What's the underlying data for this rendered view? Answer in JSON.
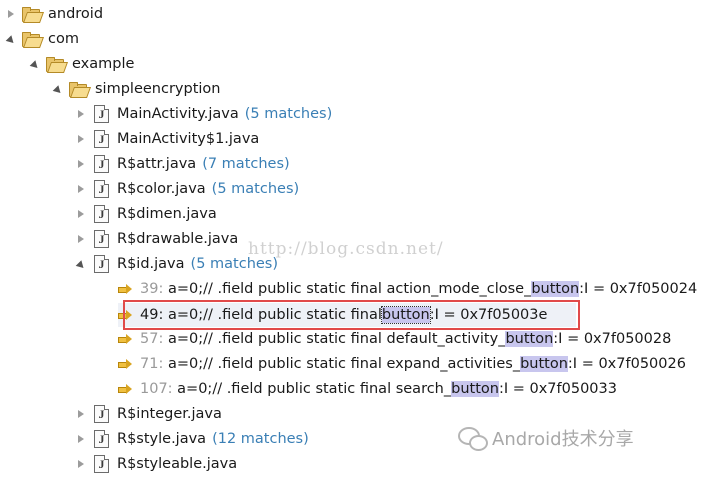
{
  "tree": {
    "android": "android",
    "com": "com",
    "example": "example",
    "simpleencryption": "simpleencryption",
    "files": [
      {
        "name": "MainActivity.java",
        "matches": "(5 matches)"
      },
      {
        "name": "MainActivity$1.java",
        "matches": ""
      },
      {
        "name": "R$attr.java",
        "matches": "(7 matches)"
      },
      {
        "name": "R$color.java",
        "matches": "(5 matches)"
      },
      {
        "name": "R$dimen.java",
        "matches": ""
      },
      {
        "name": "R$drawable.java",
        "matches": ""
      },
      {
        "name": "R$id.java",
        "matches": "(5 matches)"
      },
      {
        "name": "R$integer.java",
        "matches": ""
      },
      {
        "name": "R$style.java",
        "matches": "(12 matches)"
      },
      {
        "name": "R$styleable.java",
        "matches": ""
      }
    ],
    "rid_matches": [
      {
        "line": "39:",
        "pre": "a=0;// .field public static final action_mode_close_",
        "hit": "button",
        "post": ":I = 0x7f050024"
      },
      {
        "line": "49:",
        "pre": "a=0;// .field public static final ",
        "hit": "button",
        "post": ":I = 0x7f05003e"
      },
      {
        "line": "57:",
        "pre": "a=0;// .field public static final default_activity_",
        "hit": "button",
        "post": ":I = 0x7f050028"
      },
      {
        "line": "71:",
        "pre": "a=0;// .field public static final expand_activities_",
        "hit": "button",
        "post": ":I = 0x7f050026"
      },
      {
        "line": "107:",
        "pre": "a=0;// .field public static final search_",
        "hit": "button",
        "post": ":I = 0x7f050033"
      }
    ]
  },
  "watermark": {
    "url": "http://blog.csdn.net/",
    "brand": "Android技术分享"
  },
  "colors": {
    "highlight": "#c8c6ee",
    "matches": "#3a7fb5",
    "red_box": "#e14a4a"
  }
}
